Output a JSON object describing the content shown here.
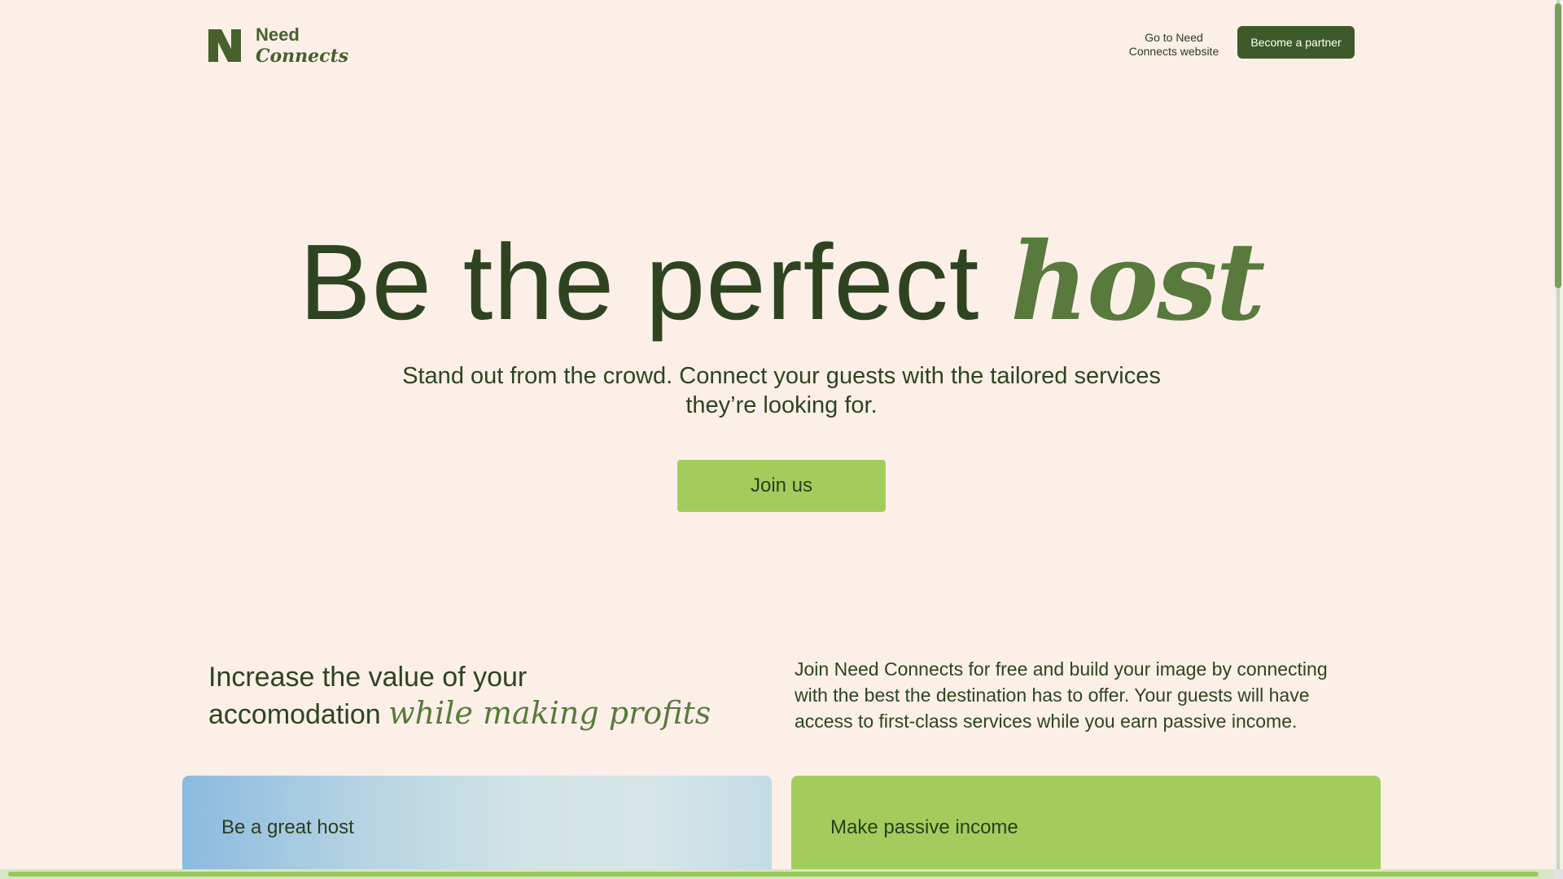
{
  "header": {
    "logo_line1": "Need",
    "logo_line2": "Connects",
    "website_link_line1": "Go to Need",
    "website_link_line2": "Connects website",
    "partner_button": "Become a partner"
  },
  "hero": {
    "title_main": "Be the perfect",
    "title_accent": "host",
    "subtitle_line1": "Stand out from the crowd. Connect your guests with the tailored services",
    "subtitle_line2": "they’re looking for.",
    "cta": "Join us"
  },
  "value": {
    "heading_line1": "Increase the value of your",
    "heading_line2": "accomodation",
    "heading_accent": "while making profits",
    "description": "Join Need Connects for free and build your image by connecting with the best the destination has to offer. Your guests will have access to first-class services while you earn passive income."
  },
  "cards": [
    {
      "label": "Be a great host"
    },
    {
      "label": "Make passive income"
    }
  ],
  "colors": {
    "background": "#fcefe8",
    "brand_dark": "#3d5a28",
    "accent_green": "#a2cd5c",
    "text_dark": "#2e4420",
    "accent_italic": "#587a3c"
  },
  "icons": {
    "logo": "need-connects-n-logo-icon"
  }
}
